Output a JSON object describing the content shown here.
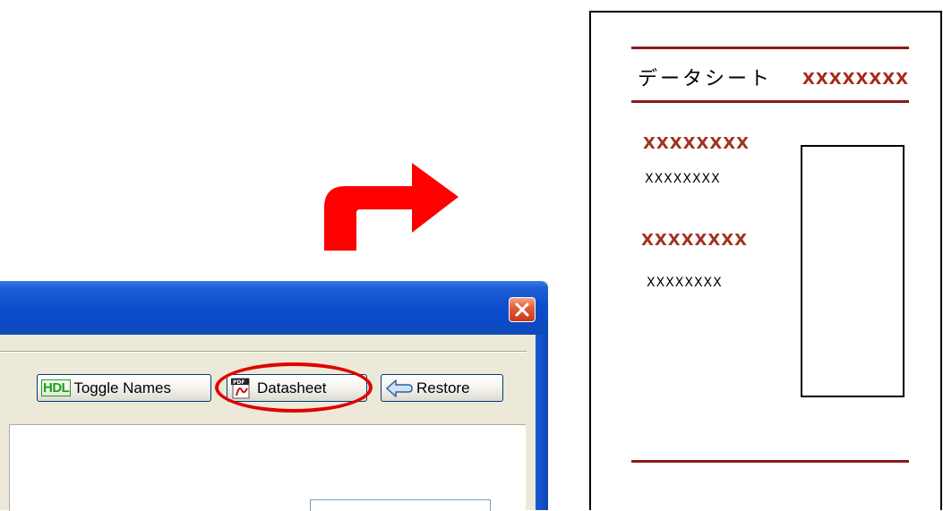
{
  "toolbar": {
    "toggle_names": {
      "tag": "HDL",
      "label": "Toggle Names"
    },
    "datasheet": {
      "label": "Datasheet"
    },
    "restore": {
      "label": "Restore"
    }
  },
  "colors": {
    "title_bar": "#0b49c7",
    "close_button": "#d9452a",
    "highlight": "#e00000",
    "arrow": "#ff0000",
    "doc_rule": "#8b1a1a",
    "doc_heading": "#a0341f",
    "hdl_tag": "#17a317"
  },
  "icons": {
    "close": "close-icon",
    "datasheet": "pdf-icon",
    "restore": "restore-arrow-icon",
    "arrow": "curved-arrow-icon"
  },
  "datasheet_doc": {
    "title": "データシート",
    "title_value": "XXXXXXXX",
    "sections": [
      {
        "heading": "XXXXXXXX",
        "text": "XXXXXXXX"
      },
      {
        "heading": "XXXXXXXX",
        "text": "XXXXXXXX"
      }
    ]
  }
}
